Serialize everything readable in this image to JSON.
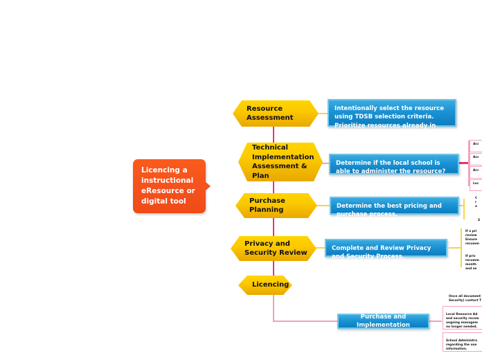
{
  "diagram": {
    "title": "Licencing a instructional eResource or digital tool",
    "type": "mind-map"
  },
  "root": {
    "label": "Licencing a instructional eResource or digital tool",
    "color": "#f4511e"
  },
  "branches": [
    {
      "id": "resource-assessment",
      "label": "Resource Assessment",
      "color": "#fcc900",
      "detail": "Intentionally select the resource using TDSB selection criteria.   Prioritize resources already in use in TDSB schools.",
      "detail_color": "#1b93d4"
    },
    {
      "id": "technical-implementation-assessment-and-plan",
      "label": "Technical Implementation Assessment & Plan",
      "color": "#fcc900",
      "detail": "Determine if the local school is able to administer the resource?",
      "detail_color": "#1b93d4"
    },
    {
      "id": "purchase-planning",
      "label": "Purchase Planning",
      "color": "#fcc900",
      "detail": "Determine the best pricing and purchase process.",
      "detail_color": "#1b93d4"
    },
    {
      "id": "privacy-and-security-review",
      "label": "Privacy and Security Review",
      "color": "#fcc900",
      "detail": "Complete and Review Privacy and Security Process.",
      "detail_color": "#1b93d4"
    },
    {
      "id": "licencing",
      "label": "Licencing",
      "color": "#fcc900",
      "detail": "",
      "detail_color": "#1b93d4"
    }
  ],
  "purchase_and_implementation": {
    "label": "Purchase and Implementation",
    "color": "#1b93d4"
  },
  "technical_leaves": [
    {
      "text": "Acc"
    },
    {
      "text": "Acc"
    },
    {
      "text": "Acc"
    },
    {
      "text": "Loc"
    }
  ],
  "purchase_leaves": [
    {
      "text": "C\nr\na"
    },
    {
      "text": "S"
    }
  ],
  "privacy_leaves": [
    {
      "text": "If a pri\nreview\nEnsure\nrecomm"
    },
    {
      "text": "If priv\nrecomm\nmonth\nand se"
    }
  ],
  "implementation_leaves": [
    {
      "text": "Once all document\nSecurity) contact T"
    },
    {
      "text": "Local Resource Ad\nand security recom\nongoing managem\nno longer needed."
    },
    {
      "text": "School Administra\nregarding the use\ninformation."
    }
  ],
  "colors": {
    "root": "#f4511e",
    "branch": "#fcc900",
    "detail": "#1b93d4",
    "connector_pink": "#ec2f72",
    "connector_pink_light": "#f49ec0",
    "connector_yellow": "#f6d54a",
    "background": "#ffffff"
  }
}
